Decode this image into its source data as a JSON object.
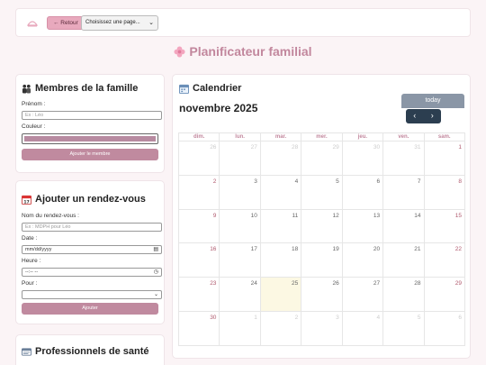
{
  "header": {
    "back_label": "← Retour",
    "page_select": "Choisissez une page..."
  },
  "title": "Planificateur familial",
  "family": {
    "title": "Membres de la famille",
    "name_label": "Prénom :",
    "name_placeholder": "Ex : Léo",
    "color_label": "Couleur :",
    "color_value": "#b78aa0",
    "add_label": "Ajouter le membre"
  },
  "appointment": {
    "title": "Ajouter un rendez-vous",
    "name_label": "Nom du rendez-vous :",
    "name_placeholder": "Ex : MDPH pour Léo",
    "date_label": "Date :",
    "date_value": "mm/dd/yyyy",
    "time_label": "Heure :",
    "time_value": "--:-- --",
    "for_label": "Pour :",
    "submit_label": "Ajouter"
  },
  "professionals": {
    "title": "Professionnels de santé"
  },
  "calendar": {
    "title": "Calendrier",
    "month": "novembre 2025",
    "today_label": "today",
    "weekdays": [
      "dim.",
      "lun.",
      "mar.",
      "mer.",
      "jeu.",
      "ven.",
      "sam."
    ],
    "weeks": [
      [
        "26",
        "27",
        "28",
        "29",
        "30",
        "31",
        "1"
      ],
      [
        "2",
        "3",
        "4",
        "5",
        "6",
        "7",
        "8"
      ],
      [
        "9",
        "10",
        "11",
        "12",
        "13",
        "14",
        "15"
      ],
      [
        "16",
        "17",
        "18",
        "19",
        "20",
        "21",
        "22"
      ],
      [
        "23",
        "24",
        "25",
        "26",
        "27",
        "28",
        "29"
      ],
      [
        "30",
        "1",
        "2",
        "3",
        "4",
        "5",
        "6"
      ]
    ]
  },
  "colors": {
    "accent": "#c2879d",
    "button": "#c08a9f",
    "nav": "#2c3e50",
    "today_bg": "#fcf8e3"
  }
}
